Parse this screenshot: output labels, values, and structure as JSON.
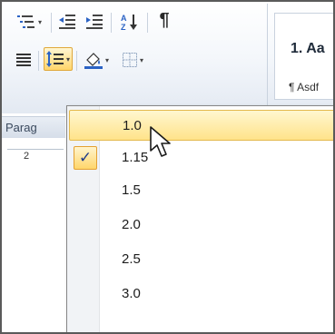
{
  "ribbon": {
    "group_label": "Parag",
    "ruler_number": "2",
    "styles_heading": "1. Aa",
    "styles_sub": "¶ Asdf",
    "sort_icon_label": "A Z",
    "pilcrow": "¶"
  },
  "line_spacing_menu": {
    "items": [
      {
        "label": "1.0",
        "highlighted": true,
        "checked": false
      },
      {
        "label": "1.15",
        "highlighted": false,
        "checked": true
      },
      {
        "label": "1.5",
        "highlighted": false,
        "checked": false
      },
      {
        "label": "2.0",
        "highlighted": false,
        "checked": false
      },
      {
        "label": "2.5",
        "highlighted": false,
        "checked": false
      },
      {
        "label": "3.0",
        "highlighted": false,
        "checked": false
      }
    ],
    "check_glyph": "✓"
  },
  "colors": {
    "highlight": "#ffe38a",
    "check": "#1e3a8a",
    "ribbon_bg": "#e3e9f2"
  },
  "icons": [
    "multilevel-list-icon",
    "decrease-indent-icon",
    "increase-indent-icon",
    "sort-icon",
    "pilcrow-icon",
    "align-justify-icon",
    "line-spacing-icon",
    "shading-icon",
    "borders-icon",
    "mouse-cursor-icon"
  ]
}
